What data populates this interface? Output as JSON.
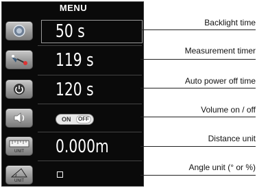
{
  "menu_title": "MENU",
  "rows": [
    {
      "icon": "backlight-icon",
      "value": "50 s",
      "callout": "Backlight time"
    },
    {
      "icon": "measurement-timer-icon",
      "value": "119 s",
      "callout": "Measurement timer"
    },
    {
      "icon": "power-icon",
      "value": "120 s",
      "callout": "Auto power off time"
    },
    {
      "icon": "speaker-icon",
      "toggle": {
        "on": "ON",
        "off": "OFF"
      },
      "callout": "Volume on / off"
    },
    {
      "icon": "unit-ruler-icon",
      "icon_text": "UNIT",
      "value": "0.000m",
      "callout": "Distance unit"
    },
    {
      "icon": "angle-unit-icon",
      "icon_text": "UNIT",
      "checkbox": true,
      "callout": "Angle unit (° or %)"
    }
  ]
}
